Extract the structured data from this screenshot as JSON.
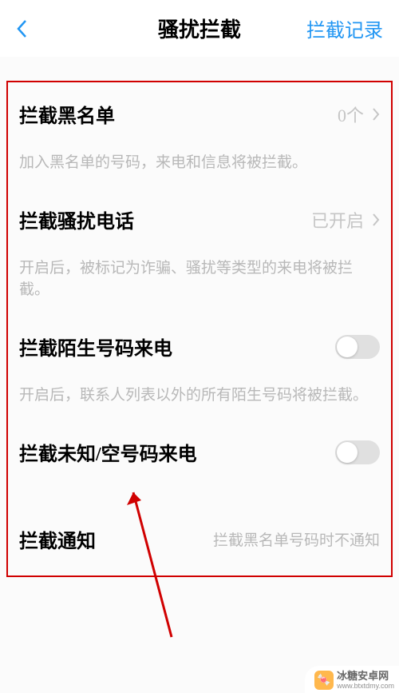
{
  "header": {
    "title": "骚扰拦截",
    "action": "拦截记录"
  },
  "rows": {
    "blacklist": {
      "label": "拦截黑名单",
      "value": "0个",
      "desc": "加入黑名单的号码，来电和信息将被拦截。"
    },
    "spam_call": {
      "label": "拦截骚扰电话",
      "value": "已开启",
      "desc": "开启后，被标记为诈骗、骚扰等类型的来电将被拦截。"
    },
    "stranger": {
      "label": "拦截陌生号码来电",
      "desc": "开启后，联系人列表以外的所有陌生号码将被拦截。"
    },
    "unknown": {
      "label": "拦截未知/空号码来电"
    },
    "notification": {
      "label": "拦截通知",
      "value": "拦截黑名单号码时不通知"
    }
  },
  "watermark": {
    "text": "冰糖安卓网",
    "url": "www.btxtdmy.com"
  }
}
